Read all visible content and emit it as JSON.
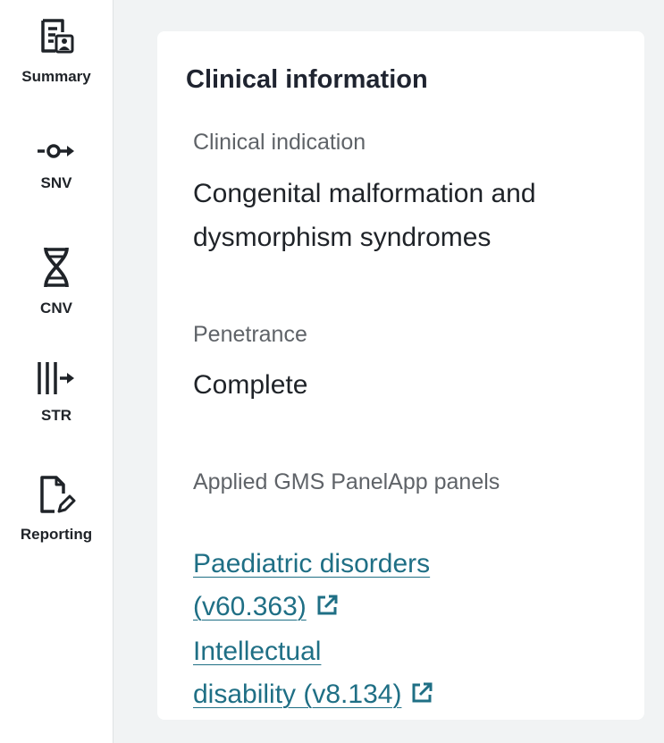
{
  "sidebar": {
    "items": [
      {
        "label": "Summary",
        "icon": "summary-icon"
      },
      {
        "label": "SNV",
        "icon": "snv-icon"
      },
      {
        "label": "CNV",
        "icon": "dna-icon"
      },
      {
        "label": "STR",
        "icon": "str-icon"
      },
      {
        "label": "Reporting",
        "icon": "report-edit-icon"
      }
    ]
  },
  "card": {
    "title": "Clinical information",
    "clinical_indication": {
      "label": "Clinical indication",
      "value": "Congenital malformation and dysmorphism syndromes"
    },
    "penetrance": {
      "label": "Penetrance",
      "value": "Complete"
    },
    "panels": {
      "label": "Applied GMS PanelApp panels",
      "items": [
        {
          "text_line1": "Paediatric disorders",
          "text_line2": "(v60.363)",
          "icon": "external-link-icon"
        },
        {
          "text_line1": "Intellectual",
          "text_line2": "disability (v8.134)",
          "icon": "external-link-icon"
        }
      ]
    }
  },
  "colors": {
    "link": "#1f6f85",
    "page_bg": "#f1f3f4",
    "text": "#1f2328",
    "muted": "#5f6368"
  }
}
